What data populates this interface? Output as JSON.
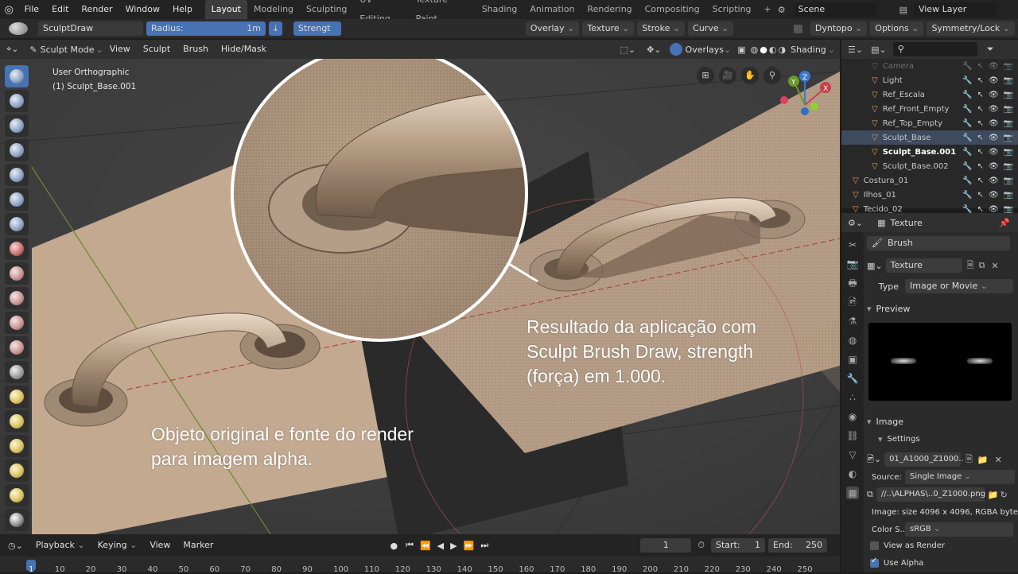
{
  "topbar": {
    "menus": [
      "File",
      "Edit",
      "Render",
      "Window",
      "Help"
    ],
    "workspaces": [
      "Layout",
      "Modeling",
      "Sculpting",
      "UV Editing",
      "Texture Paint",
      "Shading",
      "Animation",
      "Rendering",
      "Compositing",
      "Scripting"
    ],
    "active_workspace": "Layout",
    "scene": "Scene",
    "view_layer": "View Layer"
  },
  "toolbar": {
    "brush_name": "SculptDraw",
    "radius_label": "Radius:",
    "radius_value": "1m",
    "strength_label": "Strengt",
    "overlay": "Overlay",
    "texture": "Texture",
    "stroke": "Stroke",
    "curve": "Curve",
    "dyntopo": "Dyntopo",
    "options": "Options",
    "symmetry": "Symmetry/Lock"
  },
  "viewport_header": {
    "mode": "Sculpt Mode",
    "menus": [
      "View",
      "Sculpt",
      "Brush",
      "Hide/Mask"
    ],
    "overlays": "Overlays",
    "shading": "Shading"
  },
  "viewport": {
    "view_name": "User Orthographic",
    "object_name": "(1) Sculpt_Base.001",
    "annotation_right": [
      "Resultado da aplicação com",
      "Sculpt Brush Draw, strength",
      "(força) em 1.000."
    ],
    "annotation_left": [
      "Objeto original e fonte do render",
      "para imagem alpha."
    ],
    "gizmo_axes": [
      "X",
      "Y",
      "Z"
    ]
  },
  "outliner": {
    "rows": [
      {
        "name": "Camera",
        "indent": 2
      },
      {
        "name": "Light",
        "indent": 2
      },
      {
        "name": "Ref_Escala",
        "indent": 2
      },
      {
        "name": "Ref_Front_Empty",
        "indent": 2
      },
      {
        "name": "Ref_Top_Empty",
        "indent": 2
      },
      {
        "name": "Sculpt_Base",
        "indent": 2,
        "selected": true
      },
      {
        "name": "Sculpt_Base.001",
        "indent": 2,
        "bold": true
      },
      {
        "name": "Sculpt_Base.002",
        "indent": 2
      },
      {
        "name": "Costura_01",
        "indent": 1
      },
      {
        "name": "Ilhos_01",
        "indent": 1
      },
      {
        "name": "Tecido_02",
        "indent": 1
      }
    ]
  },
  "properties": {
    "header": "Texture",
    "brush": "Brush",
    "texture_name": "Texture",
    "type_label": "Type",
    "type_value": "Image or Movie",
    "preview_label": "Preview",
    "image_label": "Image",
    "settings_label": "Settings",
    "image_name": "01_A1000_Z1000..",
    "source_label": "Source:",
    "source_value": "Single Image",
    "filepath": "//..\\ALPHAS\\..0_Z1000.png",
    "image_info": "Image: size 4096 x 4096, RGBA byte",
    "color_space_label": "Color S..",
    "color_space_value": "sRGB",
    "view_as_render": "View as Render",
    "view_as_render_checked": false,
    "use_alpha": "Use Alpha",
    "use_alpha_checked": true
  },
  "timeline": {
    "menus": [
      "Playback",
      "Keying",
      "View",
      "Marker"
    ],
    "current_frame": "1",
    "start_label": "Start:",
    "start_value": "1",
    "end_label": "End:",
    "end_value": "250",
    "ticks": [
      "1",
      "10",
      "20",
      "30",
      "40",
      "50",
      "60",
      "70",
      "80",
      "90",
      "100",
      "110",
      "120",
      "130",
      "140",
      "150",
      "160",
      "170",
      "180",
      "190",
      "200",
      "210",
      "220",
      "230",
      "240",
      "250"
    ]
  },
  "colors": {
    "accent": "#4772b3",
    "mesh": "#c2a990",
    "background": "#3c3c3c"
  }
}
